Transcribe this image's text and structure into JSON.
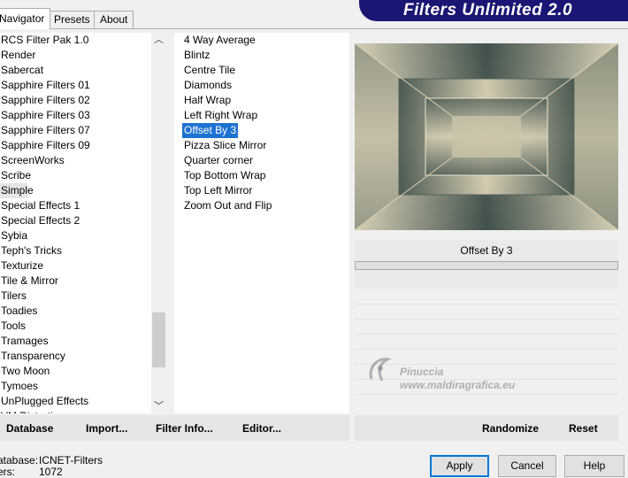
{
  "tabs": [
    {
      "label": "Navigator",
      "active": true
    },
    {
      "label": "Presets",
      "active": false
    },
    {
      "label": "About",
      "active": false
    }
  ],
  "title": "Filters Unlimited 2.0",
  "categories": [
    "RCS Filter Pak 1.0",
    "Render",
    "Sabercat",
    "Sapphire Filters 01",
    "Sapphire Filters 02",
    "Sapphire Filters 03",
    "Sapphire Filters 07",
    "Sapphire Filters 09",
    "ScreenWorks",
    "Scribe",
    "Simple",
    "Special Effects 1",
    "Special Effects 2",
    "Sybia",
    "Teph's Tricks",
    "Texturize",
    "Tile & Mirror",
    "Tilers",
    "Toadies",
    "Tools",
    "Tramages",
    "Transparency",
    "Two Moon",
    "Tymoes",
    "UnPlugged Effects",
    "VM Distortion"
  ],
  "selected_category": "Simple",
  "filters": [
    "4 Way Average",
    "Blintz",
    "Centre Tile",
    "Diamonds",
    "Half Wrap",
    "Left Right Wrap",
    "Offset By 3",
    "Pizza Slice Mirror",
    "Quarter corner",
    "Top Bottom Wrap",
    "Top Left Mirror",
    "Zoom Out and Flip"
  ],
  "selected_filter": "Offset By 3",
  "preview": {
    "filter_name": "Offset By 3"
  },
  "colors": {
    "banner": "#1a1673",
    "selection": "#1e72d1",
    "preview_dark": "#3f5049",
    "preview_light": "#e8dfc5"
  },
  "bottom_links": {
    "database": "Database",
    "import": "Import...",
    "filter_info": "Filter Info...",
    "editor": "Editor..."
  },
  "bottom_actions": {
    "randomize": "Randomize",
    "reset": "Reset"
  },
  "info": {
    "database_label": "atabase:",
    "database_value": "ICNET-Filters",
    "filters_label": "ers:",
    "filters_value": "1072"
  },
  "buttons": {
    "apply": "Apply",
    "cancel": "Cancel",
    "help": "Help"
  },
  "watermark": {
    "line1": "Pinuccia",
    "line2": "www.maldiragrafica.eu"
  },
  "scroll_icons": {
    "up": "chevron-up-icon",
    "down": "chevron-down-icon"
  }
}
